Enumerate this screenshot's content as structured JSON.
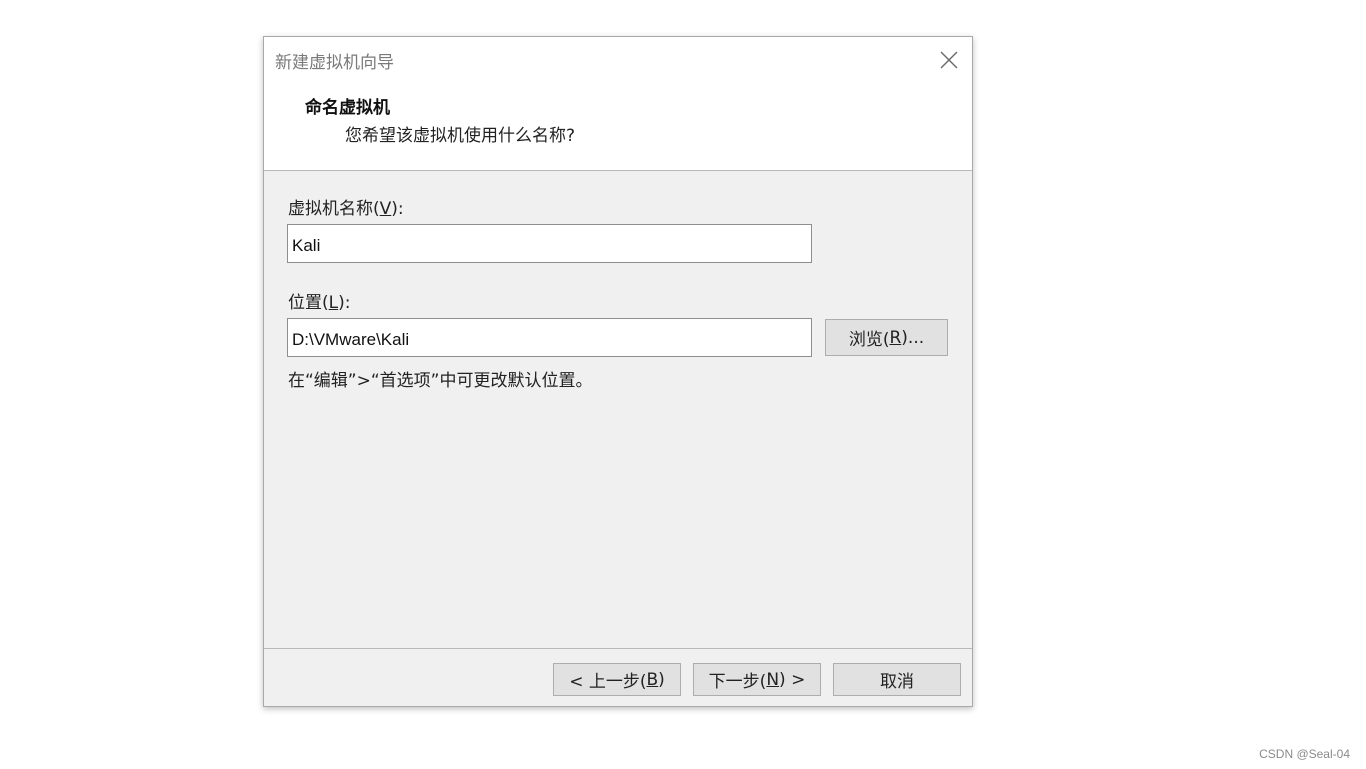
{
  "window": {
    "title": "新建虚拟机向导",
    "close_icon": "close-icon"
  },
  "header": {
    "heading": "命名虚拟机",
    "subheading": "您希望该虚拟机使用什么名称?"
  },
  "name_field": {
    "label_prefix": "虚拟机名称(",
    "label_mnemonic": "V",
    "label_suffix": "):",
    "value": "Kali"
  },
  "location_field": {
    "label_prefix": "位置(",
    "label_mnemonic": "L",
    "label_suffix": "):",
    "value": "D:\\VMware\\Kali"
  },
  "browse_button": {
    "prefix": "浏览(",
    "mnemonic": "R",
    "suffix": ")..."
  },
  "hint": "在“编辑”>“首选项”中可更改默认位置。",
  "footer": {
    "back": {
      "prefix": "< 上一步(",
      "mnemonic": "B",
      "suffix": ")"
    },
    "next": {
      "prefix": "下一步(",
      "mnemonic": "N",
      "suffix": ") >"
    },
    "cancel": "取消"
  },
  "watermark": "CSDN @Seal-04"
}
